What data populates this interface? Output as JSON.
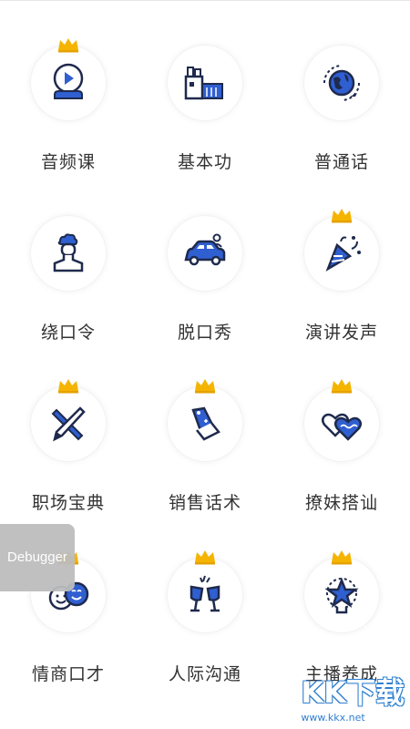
{
  "colors": {
    "primary": "#2f5fd0",
    "navy": "#1f2a4d",
    "crown": "#f4b400",
    "label": "#333333"
  },
  "items": [
    {
      "label": "音频课",
      "icon": "video-course-icon",
      "crown": true
    },
    {
      "label": "基本功",
      "icon": "factory-icon",
      "crown": false
    },
    {
      "label": "普通话",
      "icon": "globe-plane-icon",
      "crown": false
    },
    {
      "label": "绕口令",
      "icon": "chef-person-icon",
      "crown": false
    },
    {
      "label": "脱口秀",
      "icon": "car-person-icon",
      "crown": false
    },
    {
      "label": "演讲发声",
      "icon": "party-popper-icon",
      "crown": true
    },
    {
      "label": "职场宝典",
      "icon": "brush-pen-icon",
      "crown": true
    },
    {
      "label": "销售话术",
      "icon": "price-tag-icon",
      "crown": true
    },
    {
      "label": "撩妹搭讪",
      "icon": "hearts-icon",
      "crown": true
    },
    {
      "label": "情商口才",
      "icon": "smiling-faces-icon",
      "crown": true
    },
    {
      "label": "人际沟通",
      "icon": "toast-glasses-icon",
      "crown": true
    },
    {
      "label": "主播养成",
      "icon": "star-trophy-icon",
      "crown": true
    }
  ],
  "debugger": {
    "label": "Debugger"
  },
  "watermark": {
    "brand": "KK下载",
    "url": "www.kkx.net"
  }
}
